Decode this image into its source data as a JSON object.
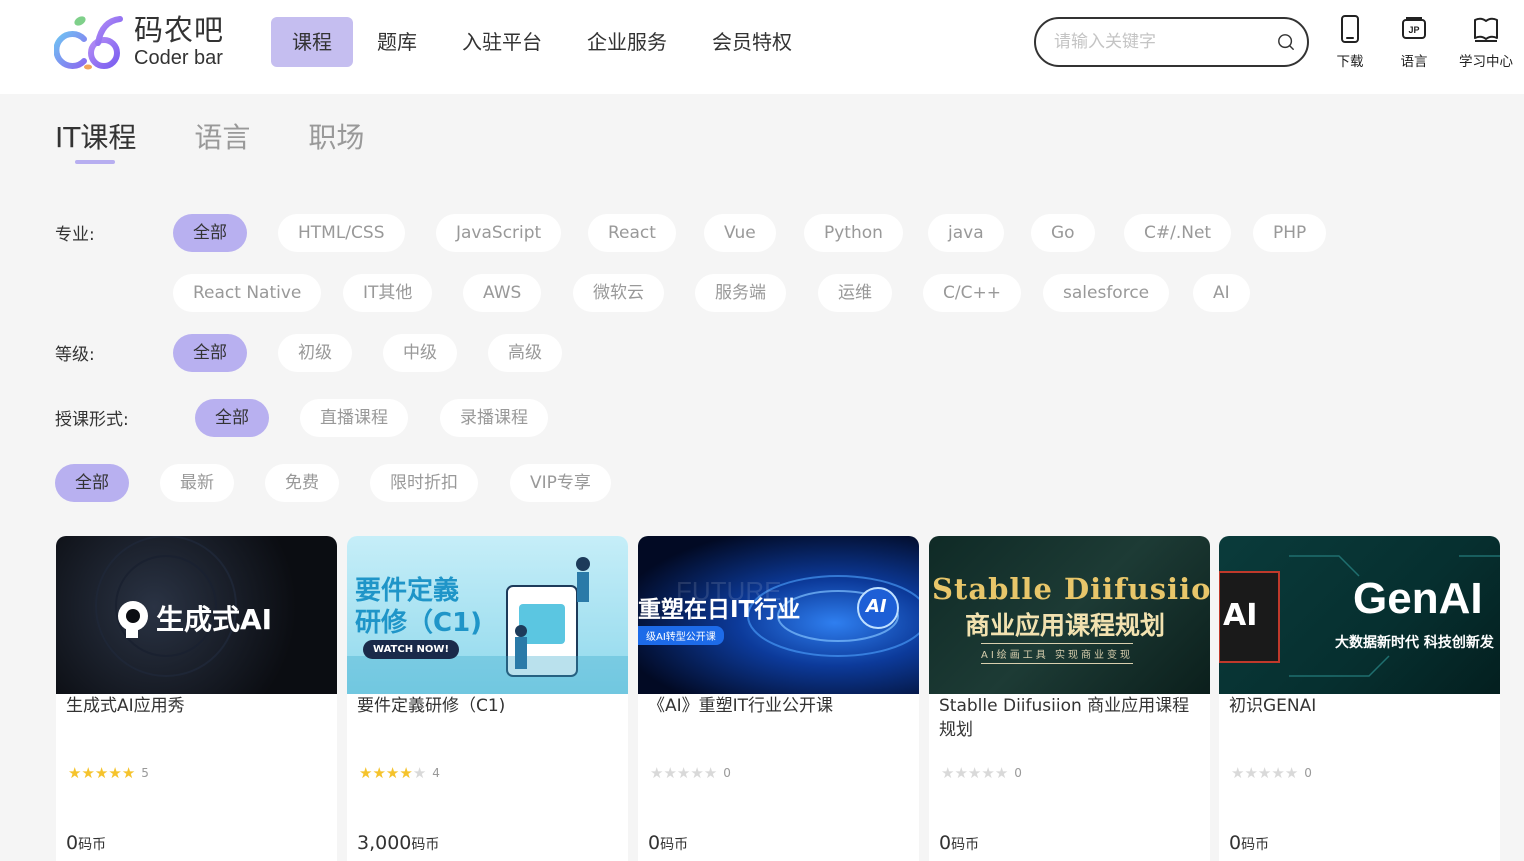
{
  "brand": {
    "name_cn": "码农吧",
    "name_en": "Coder bar"
  },
  "nav": [
    {
      "label": "课程",
      "active": true
    },
    {
      "label": "题库",
      "active": false
    },
    {
      "label": "入驻平台",
      "active": false
    },
    {
      "label": "企业服务",
      "active": false
    },
    {
      "label": "会员特权",
      "active": false
    }
  ],
  "search": {
    "placeholder": "请输入关键字",
    "value": ""
  },
  "tools": [
    {
      "label": "下载",
      "icon": "phone-icon"
    },
    {
      "label": "语言",
      "icon": "language-jp-icon"
    },
    {
      "label": "学习中心",
      "icon": "book-icon"
    }
  ],
  "category_tabs": [
    {
      "label": "IT课程",
      "active": true
    },
    {
      "label": "语言",
      "active": false
    },
    {
      "label": "职场",
      "active": false
    }
  ],
  "filters": {
    "major": {
      "label": "专业:",
      "options": [
        "全部",
        "HTML/CSS",
        "JavaScript",
        "React",
        "Vue",
        "Python",
        "java",
        "Go",
        "C#/.Net",
        "PHP",
        "React Native",
        "IT其他",
        "AWS",
        "微软云",
        "服务端",
        "运维",
        "C/C++",
        "salesforce",
        "AI"
      ],
      "selected": "全部"
    },
    "level": {
      "label": "等级:",
      "options": [
        "全部",
        "初级",
        "中级",
        "高级"
      ],
      "selected": "全部"
    },
    "format": {
      "label": "授课形式:",
      "options": [
        "全部",
        "直播课程",
        "录播课程"
      ],
      "selected": "全部"
    },
    "sort": {
      "options": [
        "全部",
        "最新",
        "免费",
        "限时折扣",
        "VIP专享"
      ],
      "selected": "全部"
    }
  },
  "courses": [
    {
      "title": "生成式AI应用秀",
      "rating": 5,
      "rating_count": "5",
      "price": "0",
      "currency": "码币",
      "banner": {
        "text": "生成式AI",
        "colors": [
          "#0b0d12",
          "#1b2230"
        ]
      }
    },
    {
      "title": "要件定義研修（C1)",
      "rating": 4,
      "rating_count": "4",
      "price": "3,000",
      "currency": "码币",
      "banner": {
        "line1": "要件定義",
        "line2": "研修（C1)",
        "button": "WATCH NOW!",
        "colors": [
          "#a9e3f3",
          "#5bc6e1"
        ]
      }
    },
    {
      "title": "《AI》重塑IT行业公开课",
      "rating": 0,
      "rating_count": "0",
      "price": "0",
      "currency": "码币",
      "banner": {
        "text": "重塑在日IT行业",
        "sub": "级AI转型公开课",
        "bg_word": "FUTURE",
        "badge": "AI",
        "colors": [
          "#020a24",
          "#0c3a9a"
        ]
      }
    },
    {
      "title": "Stablle Diifusiion 商业应用课程规划",
      "rating": 0,
      "rating_count": "0",
      "price": "0",
      "currency": "码币",
      "banner": {
        "line1": "Stablle Diifusiion",
        "line2": "商业应用课程规划",
        "sub": "AI绘画工具 实现商业变现",
        "colors": [
          "#0f2a26",
          "#1d3b35"
        ]
      }
    },
    {
      "title": "初识GENAI",
      "rating": 0,
      "rating_count": "0",
      "price": "0",
      "currency": "码币",
      "banner": {
        "badge": "AI",
        "text": "GenAI",
        "sub": "大数据新时代 科技创新发",
        "colors": [
          "#062f2f",
          "#0d4a4a"
        ]
      }
    }
  ],
  "colors": {
    "accent": "#c5bef0",
    "chip_active": "#b8b0f0",
    "star": "#f5c32c"
  }
}
